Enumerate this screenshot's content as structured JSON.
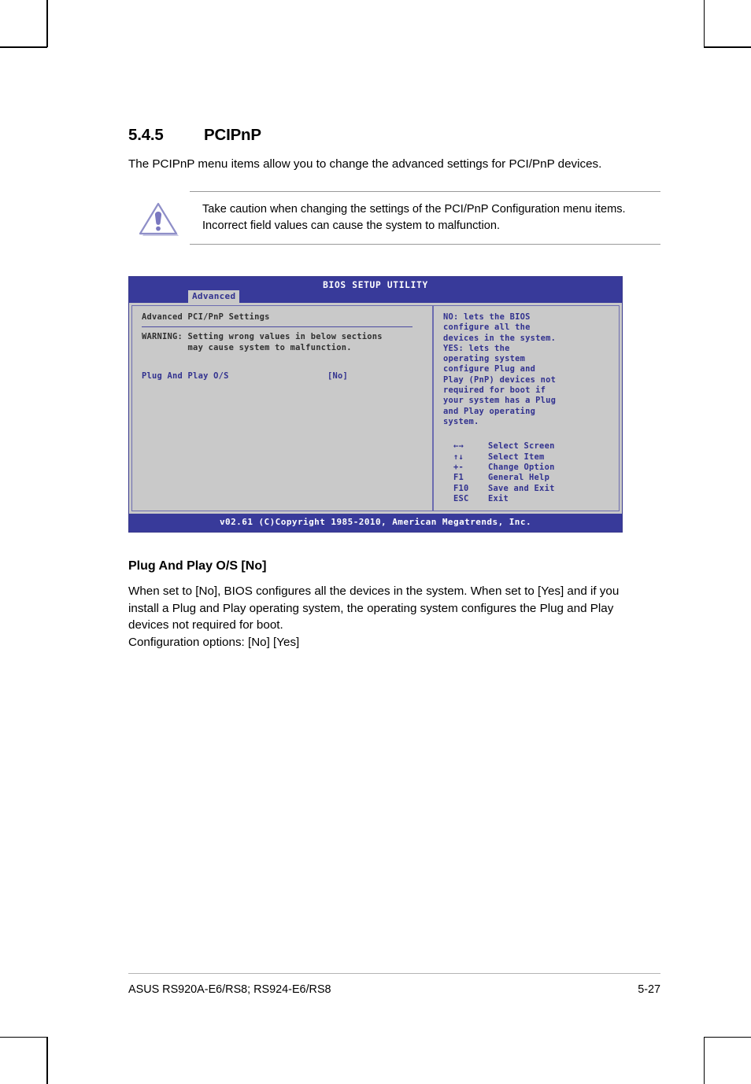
{
  "section": {
    "number": "5.4.5",
    "title": "PCIPnP",
    "intro": "The PCIPnP menu items allow you to change the advanced settings for PCI/PnP devices."
  },
  "caution": {
    "icon": "warning-triangle-icon",
    "text": "Take caution when changing the settings of the PCI/PnP Configuration menu items. Incorrect field values can cause the system to malfunction."
  },
  "bios": {
    "title": "BIOS SETUP UTILITY",
    "active_tab": "Advanced",
    "left_panel": {
      "heading": "Advanced PCI/PnP Settings",
      "warning_line1": "WARNING: Setting wrong values in below sections",
      "warning_line2": "         may cause system to malfunction.",
      "item_label": "Plug And Play O/S",
      "item_value": "[No]"
    },
    "help": "NO: lets the BIOS\nconfigure all the\ndevices in the system.\nYES: lets the\noperating system\nconfigure Plug and\nPlay (PnP) devices not\nrequired for boot if\nyour system has a Plug\nand Play operating\nsystem.",
    "keys": [
      {
        "key": "←→",
        "action": "Select Screen"
      },
      {
        "key": "↑↓",
        "action": "Select Item"
      },
      {
        "key": "+-",
        "action": "Change Option"
      },
      {
        "key": "F1",
        "action": "General Help"
      },
      {
        "key": "F10",
        "action": "Save and Exit"
      },
      {
        "key": "ESC",
        "action": "Exit"
      }
    ],
    "footer": "v02.61 (C)Copyright 1985-2010, American Megatrends, Inc.",
    "colors": {
      "header_blue": "#383a9a",
      "body_gray": "#c9c9c9",
      "text_blue": "#31318f",
      "border_blue": "#6b6bb0"
    }
  },
  "subsection": {
    "heading": "Plug And Play O/S [No]",
    "paragraph": "When set to [No], BIOS configures all the devices in the system. When set to [Yes] and if you install a Plug and Play operating system, the operating system configures the Plug and Play devices not required for boot.",
    "options_line": "Configuration options: [No] [Yes]"
  },
  "page_footer": {
    "model": "ASUS RS920A-E6/RS8; RS924-E6/RS8",
    "page_number": "5-27"
  }
}
